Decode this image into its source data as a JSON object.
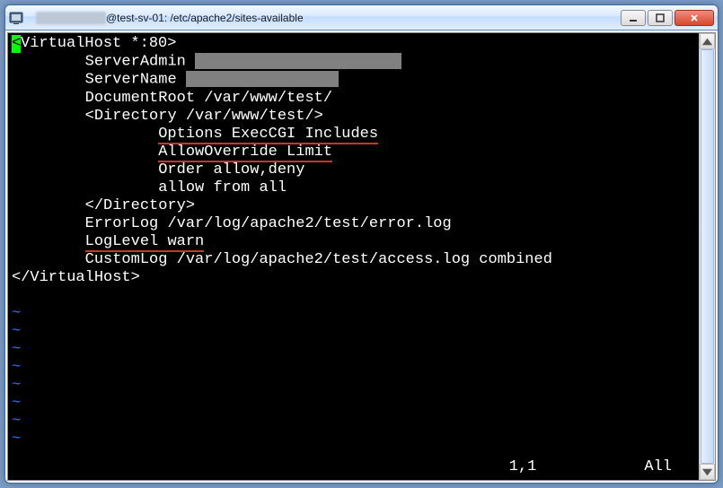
{
  "window": {
    "title": "@test-sv-01: /etc/apache2/sites-available"
  },
  "editor": {
    "cursor_char": "<",
    "line1_rest": "VirtualHost *:80>",
    "indent1": "        ",
    "indent2": "                ",
    "server_admin_label": "ServerAdmin ",
    "server_name_label": "ServerName ",
    "document_root": "DocumentRoot /var/www/test/",
    "directory_open": "<Directory /var/www/test/>",
    "options_line": "Options ExecCGI Includes",
    "allowoverride_line": "AllowOverride Limit",
    "order_line": "Order allow,deny",
    "allow_line": "allow from all",
    "directory_close": "</Directory>",
    "errorlog": "ErrorLog /var/log/apache2/test/error.log",
    "loglevel": "LogLevel warn",
    "customlog": "CustomLog /var/log/apache2/test/access.log combined",
    "vh_close": "</VirtualHost>",
    "tilde": "~",
    "status_pos": "1,1",
    "status_right": "All"
  }
}
